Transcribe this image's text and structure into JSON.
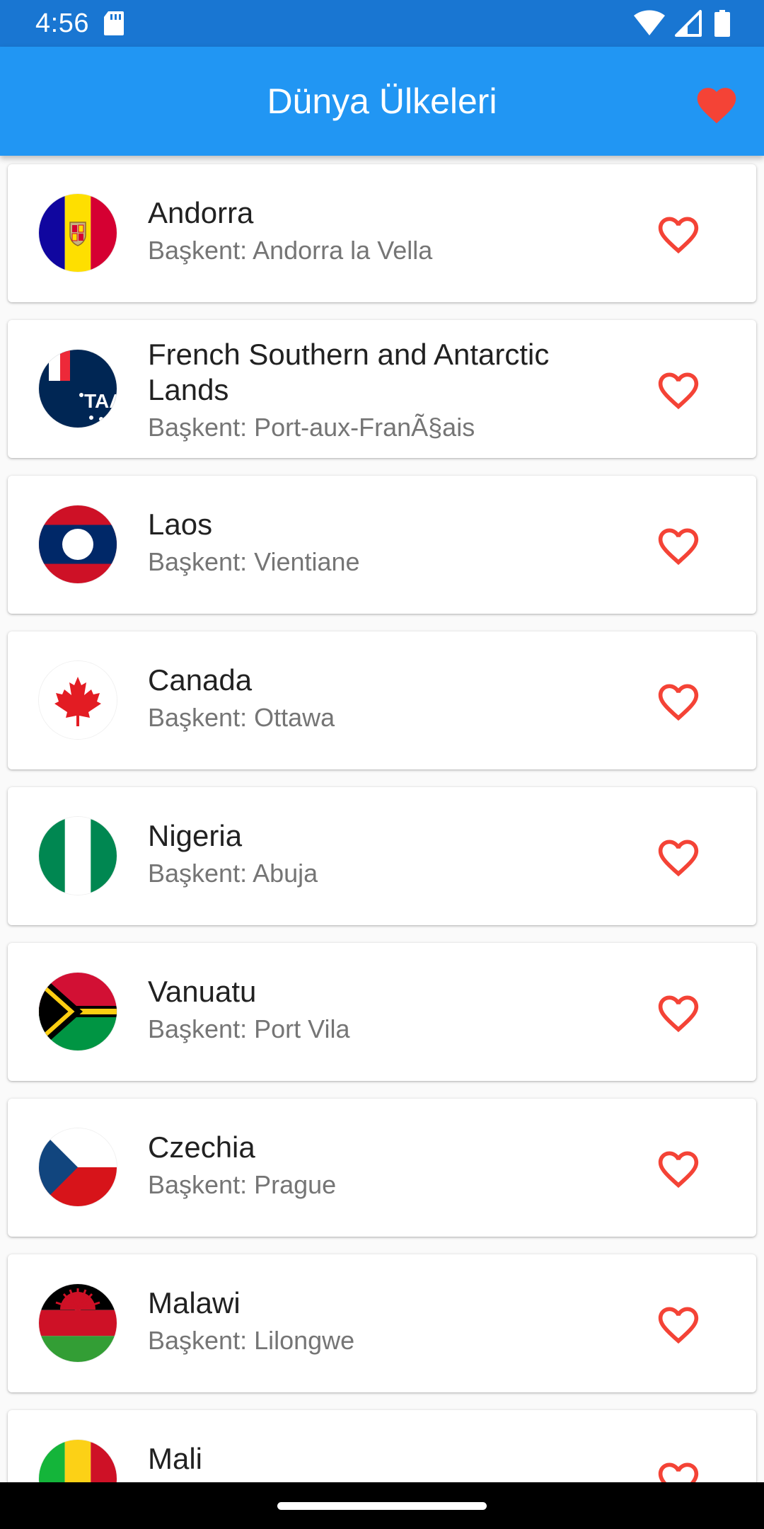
{
  "status_bar": {
    "time": "4:56"
  },
  "app_bar": {
    "title": "Dünya Ülkeleri",
    "favorites_icon": "heart-filled-icon"
  },
  "colors": {
    "app_bar": "#2196F3",
    "status_bar": "#1976D2",
    "heart": "#F44336"
  },
  "countries": [
    {
      "name": "Andorra",
      "capital": "Başkent: Andorra la Vella",
      "flag": "andorra"
    },
    {
      "name": "French Southern and Antarctic Lands",
      "capital": "Başkent: Port-aux-FranÃ§ais",
      "flag": "french-southern-lands"
    },
    {
      "name": "Laos",
      "capital": "Başkent: Vientiane",
      "flag": "laos"
    },
    {
      "name": "Canada",
      "capital": "Başkent: Ottawa",
      "flag": "canada"
    },
    {
      "name": "Nigeria",
      "capital": "Başkent: Abuja",
      "flag": "nigeria"
    },
    {
      "name": "Vanuatu",
      "capital": "Başkent: Port Vila",
      "flag": "vanuatu"
    },
    {
      "name": "Czechia",
      "capital": "Başkent: Prague",
      "flag": "czechia"
    },
    {
      "name": "Malawi",
      "capital": "Başkent: Lilongwe",
      "flag": "malawi"
    },
    {
      "name": "Mali",
      "capital": "",
      "flag": "mali"
    }
  ]
}
